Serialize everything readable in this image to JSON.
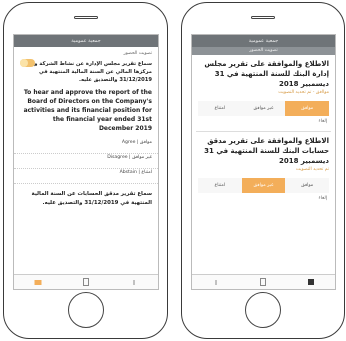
{
  "left": {
    "topbar_title": "جمعية عمومية",
    "subbar_title": "",
    "voting_label": "تصويت الحضور",
    "item1_ar": "سماع تقرير مجلس الإدارة عن نشاط الشركة وعن مركزها المالي عن السنة المالية المنتهية في 31/12/2019 والتصديق عليه.",
    "item1_en": "To hear and approve the report of the Board of Directors on the Company's activities and its financial position for the financial year ended 31st December 2019",
    "options": [
      "Agree | موافق",
      "Disagree | غير موافق",
      "Abstain | امتناع"
    ],
    "item2_ar": "سماع تقرير مدقق الحسابات عن السنة المالية المنتهية في 31/12/2019 والتصديق عليه."
  },
  "right": {
    "topbar_title": "جمعية عمومية",
    "subbar_title": "تصويت الحضور",
    "item1_title": "الاطلاع والموافقة على تقرير مجلس إدارة البنك للسنة المنتهية في 31 ديسمبير 2018",
    "item1_link": "مواافق - تم تحديد التصويت",
    "item1_buttons": [
      "امتناع",
      "غير موافق",
      "موافق"
    ],
    "item1_selected": 2,
    "item1_abstain": "إلغاء",
    "item2_title": "الاطلاع والموافقة على تقرير مدقق حسابات البنك للسنة المنتهية في 31 ديسمبير 2018",
    "item2_link": "تم تحديد التصويت",
    "item2_buttons": [
      "امتناع",
      "غير موافق",
      "موافق"
    ],
    "item2_selected": 1,
    "item2_abstain": "إلغاء"
  }
}
